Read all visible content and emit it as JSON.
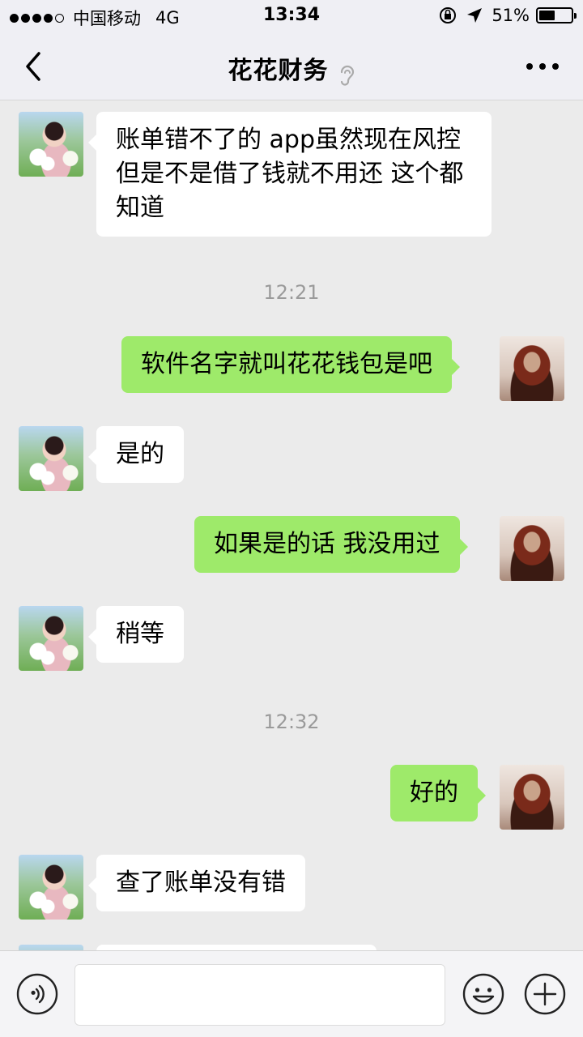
{
  "status_bar": {
    "carrier": "中国移动",
    "network": "4G",
    "time": "13:34",
    "battery_percent": "51%",
    "battery_level": 0.51,
    "icons": [
      "orientation-lock-icon",
      "location-arrow-icon",
      "battery-icon"
    ]
  },
  "nav": {
    "title": "花花财务",
    "back_icon": "chevron-left-icon",
    "earpiece_icon": "ear-icon",
    "more_icon": "more-dots-icon"
  },
  "messages": [
    {
      "side": "in",
      "text": "账单错不了的 app虽然现在风控但是不是借了钱就不用还 这个都知道"
    },
    {
      "type": "time",
      "text": "12:21"
    },
    {
      "side": "out",
      "text": "软件名字就叫花花钱包是吧"
    },
    {
      "side": "in",
      "text": "是的"
    },
    {
      "side": "out",
      "text": "如果是的话 我没用过"
    },
    {
      "side": "in",
      "text": "稍等"
    },
    {
      "type": "time",
      "text": "12:32"
    },
    {
      "side": "out",
      "text": "好的"
    },
    {
      "side": "in",
      "text": "查了账单没有错"
    }
  ],
  "input": {
    "value": "",
    "placeholder": "",
    "voice_icon": "voice-icon",
    "emoji_icon": "emoji-icon",
    "plus_icon": "plus-icon"
  },
  "colors": {
    "outgoing_bubble": "#9eea6a",
    "incoming_bubble": "#ffffff",
    "chat_background": "#ebebeb"
  }
}
